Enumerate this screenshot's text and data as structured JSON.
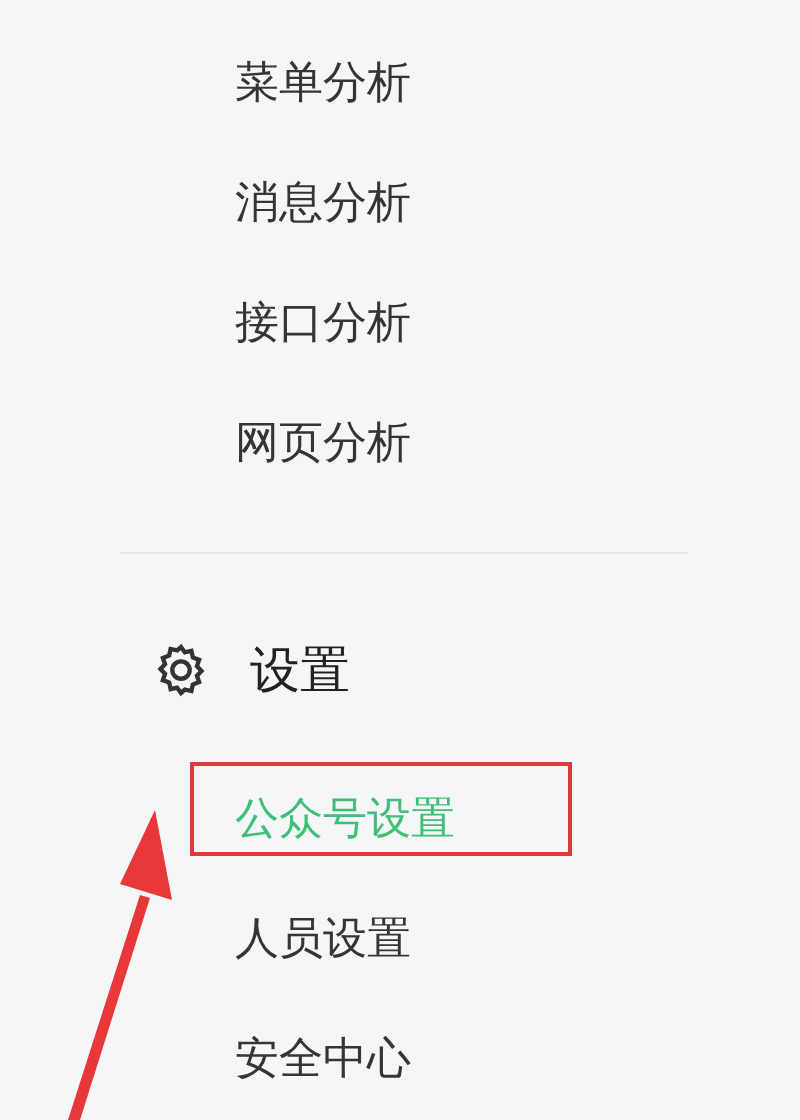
{
  "analytics_items": [
    {
      "label": "菜单分析",
      "selected": false
    },
    {
      "label": "消息分析",
      "selected": false
    },
    {
      "label": "接口分析",
      "selected": false
    },
    {
      "label": "网页分析",
      "selected": false
    }
  ],
  "settings": {
    "title": "设置",
    "items": [
      {
        "label": "公众号设置",
        "selected": true,
        "highlighted": true
      },
      {
        "label": "人员设置",
        "selected": false,
        "highlighted": false
      },
      {
        "label": "安全中心",
        "selected": false,
        "highlighted": false
      }
    ]
  }
}
